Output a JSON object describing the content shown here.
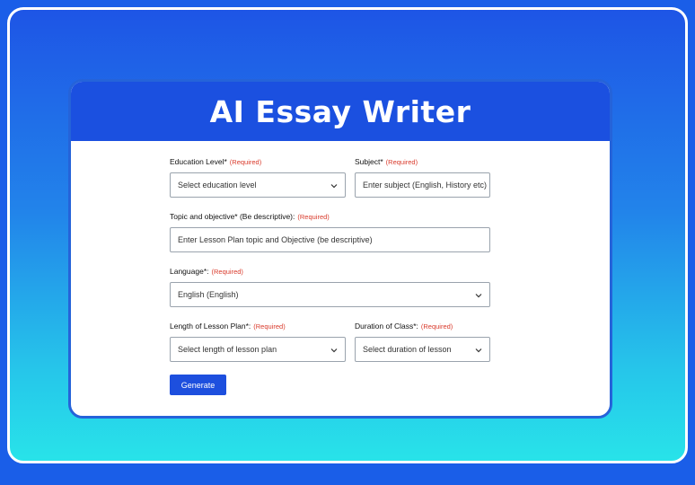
{
  "header": {
    "title": "AI Essay Writer"
  },
  "form": {
    "required_text": "(Required)",
    "education_level": {
      "label": "Education Level*",
      "value": "Select education level"
    },
    "subject": {
      "label": "Subject*",
      "placeholder": "Enter subject (English, History etc)"
    },
    "topic": {
      "label": "Topic and objective* (Be descriptive):",
      "placeholder": "Enter Lesson Plan topic and Objective (be descriptive)"
    },
    "language": {
      "label": "Language*:",
      "value": "English (English)"
    },
    "length": {
      "label": "Length of Lesson Plan*:",
      "value": "Select length of lesson plan"
    },
    "duration": {
      "label": "Duration of Class*:",
      "value": "Select duration of lesson"
    },
    "generate_label": "Generate"
  },
  "colors": {
    "background": "#1a5ee8",
    "header": "#1b50e0",
    "button": "#1d4fde",
    "required": "#d93a2b"
  },
  "icons": {
    "select": "chevron-down-icon"
  }
}
